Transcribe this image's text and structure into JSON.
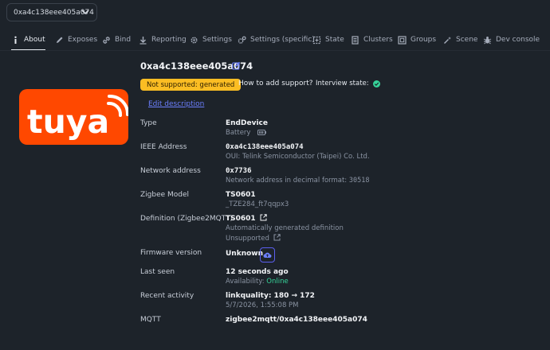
{
  "device_selector": {
    "value": "0xa4c138eee405a074",
    "icon": "chevron-down-icon"
  },
  "tabs": [
    {
      "label": "About",
      "icon": "info-icon",
      "active": true
    },
    {
      "label": "Exposes",
      "icon": "pencil-icon"
    },
    {
      "label": "Bind",
      "icon": "link-icon"
    },
    {
      "label": "Reporting",
      "icon": "download-icon"
    },
    {
      "label": "Settings",
      "icon": "gear-icon"
    },
    {
      "label": "Settings (specific)",
      "icon": "gears-icon"
    },
    {
      "label": "State",
      "icon": "state-icon"
    },
    {
      "label": "Clusters",
      "icon": "list-icon"
    },
    {
      "label": "Groups",
      "icon": "groups-icon"
    },
    {
      "label": "Scene",
      "icon": "scene-icon"
    },
    {
      "label": "Dev console",
      "icon": "bug-icon"
    }
  ],
  "logo": {
    "text": "tuya",
    "color": "#ff4800"
  },
  "device": {
    "title": "0xa4c138eee405a074",
    "support_badge": "Not supported: generated",
    "how_to_add": "How to add support?",
    "interview_label": "Interview state:",
    "edit_description": "Edit description"
  },
  "rows": {
    "type": {
      "label": "Type",
      "value": "EndDevice",
      "sub": "Battery"
    },
    "ieee": {
      "label": "IEEE Address",
      "value": "0xa4c138eee405a074",
      "sub": "OUI: Telink Semiconductor (Taipei) Co. Ltd."
    },
    "network": {
      "label": "Network address",
      "value": "0x7736",
      "sub_prefix": "Network address in decimal format:",
      "sub_value": "30518"
    },
    "model": {
      "label": "Zigbee Model",
      "value": "TS0601",
      "sub": "_TZE284_ft7qqpx3"
    },
    "definition": {
      "label": "Definition (Zigbee2MQTT)",
      "value": "TS0601",
      "sub": "Automatically generated definition",
      "sub2": "Unsupported"
    },
    "firmware": {
      "label": "Firmware version",
      "value": "Unknown"
    },
    "last_seen": {
      "label": "Last seen",
      "value": "12 seconds ago",
      "sub_prefix": "Availability:",
      "sub_value": "Online"
    },
    "activity": {
      "label": "Recent activity",
      "value": "linkquality: 180 → 172",
      "sub": "5/7/2026, 1:55:08 PM"
    },
    "mqtt": {
      "label": "MQTT",
      "value": "zigbee2mqtt/0xa4c138eee405a074"
    }
  },
  "colors": {
    "accent": "#6c7fff",
    "warning": "#fbbd23",
    "success": "#36d399",
    "background": "#1d232a"
  }
}
